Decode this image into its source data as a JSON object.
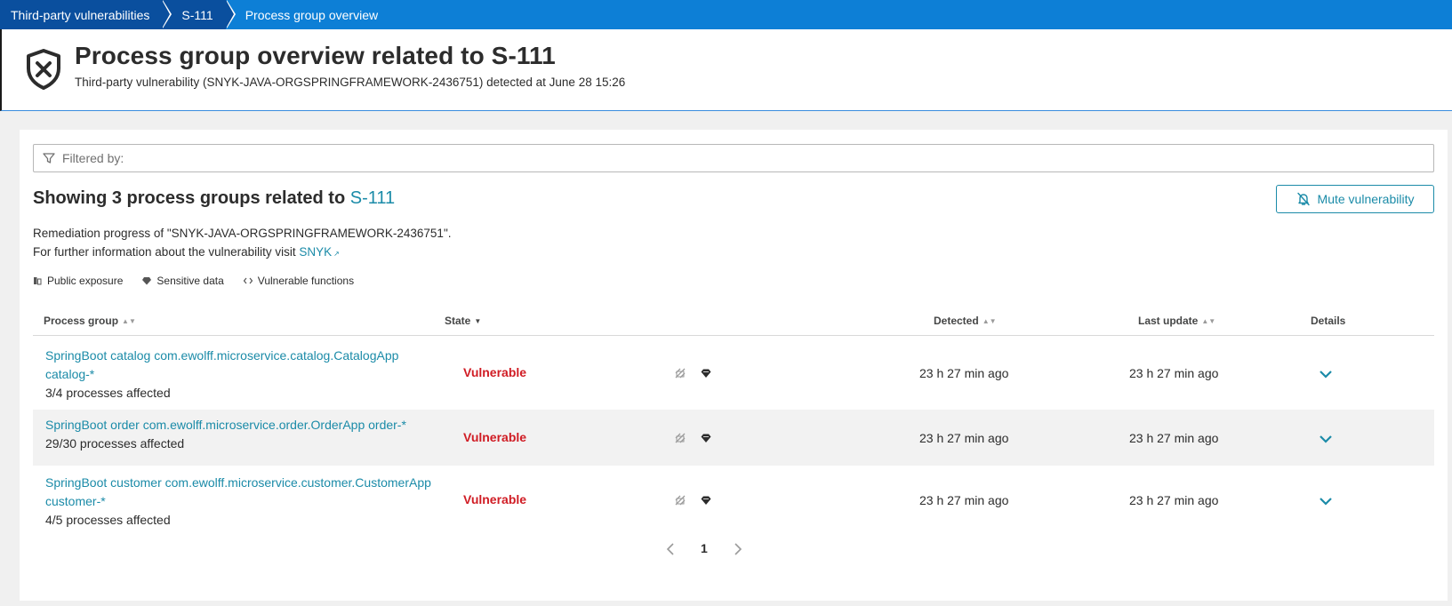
{
  "breadcrumb": [
    "Third-party vulnerabilities",
    "S-111",
    "Process group overview"
  ],
  "header": {
    "title": "Process group overview related to S-111",
    "subtitle": "Third-party vulnerability (SNYK-JAVA-ORGSPRINGFRAMEWORK-2436751) detected at June 28 15:26",
    "icon": "shield-x-icon"
  },
  "filter": {
    "placeholder": "Filtered by:"
  },
  "showing": {
    "prefix": "Showing 3 process groups related to ",
    "link": "S-111"
  },
  "mute_button": {
    "label": "Mute vulnerability",
    "icon": "bell-muted-icon"
  },
  "remediation": {
    "line1": "Remediation progress of \"SNYK-JAVA-ORGSPRINGFRAMEWORK-2436751\".",
    "line2_prefix": "For further information about the vulnerability visit ",
    "line2_link": "SNYK"
  },
  "legend": [
    {
      "label": "Public exposure",
      "icon": "public-exposure-icon"
    },
    {
      "label": "Sensitive data",
      "icon": "sensitive-data-icon"
    },
    {
      "label": "Vulnerable functions",
      "icon": "code-icon"
    }
  ],
  "table": {
    "columns": [
      "Process group",
      "State",
      "Detected",
      "Last update",
      "Details"
    ],
    "rows": [
      {
        "name_line1": "SpringBoot catalog com.ewolff.microservice.catalog.CatalogApp",
        "name_line2": "catalog-*",
        "affected": "3/4 processes affected",
        "state": "Vulnerable",
        "detected": "23 h 27 min ago",
        "last_update": "23 h 27 min ago"
      },
      {
        "name_line1": "SpringBoot order com.ewolff.microservice.order.OrderApp order-*",
        "name_line2": "",
        "affected": "29/30 processes affected",
        "state": "Vulnerable",
        "detected": "23 h 27 min ago",
        "last_update": "23 h 27 min ago"
      },
      {
        "name_line1": "SpringBoot customer com.ewolff.microservice.customer.CustomerApp",
        "name_line2": "customer-*",
        "affected": "4/5 processes affected",
        "state": "Vulnerable",
        "detected": "23 h 27 min ago",
        "last_update": "23 h 27 min ago"
      }
    ]
  },
  "pagination": {
    "current": "1"
  },
  "colors": {
    "accent": "#1b8ba8",
    "danger": "#d01c24",
    "brand": "#0d7fd6"
  }
}
